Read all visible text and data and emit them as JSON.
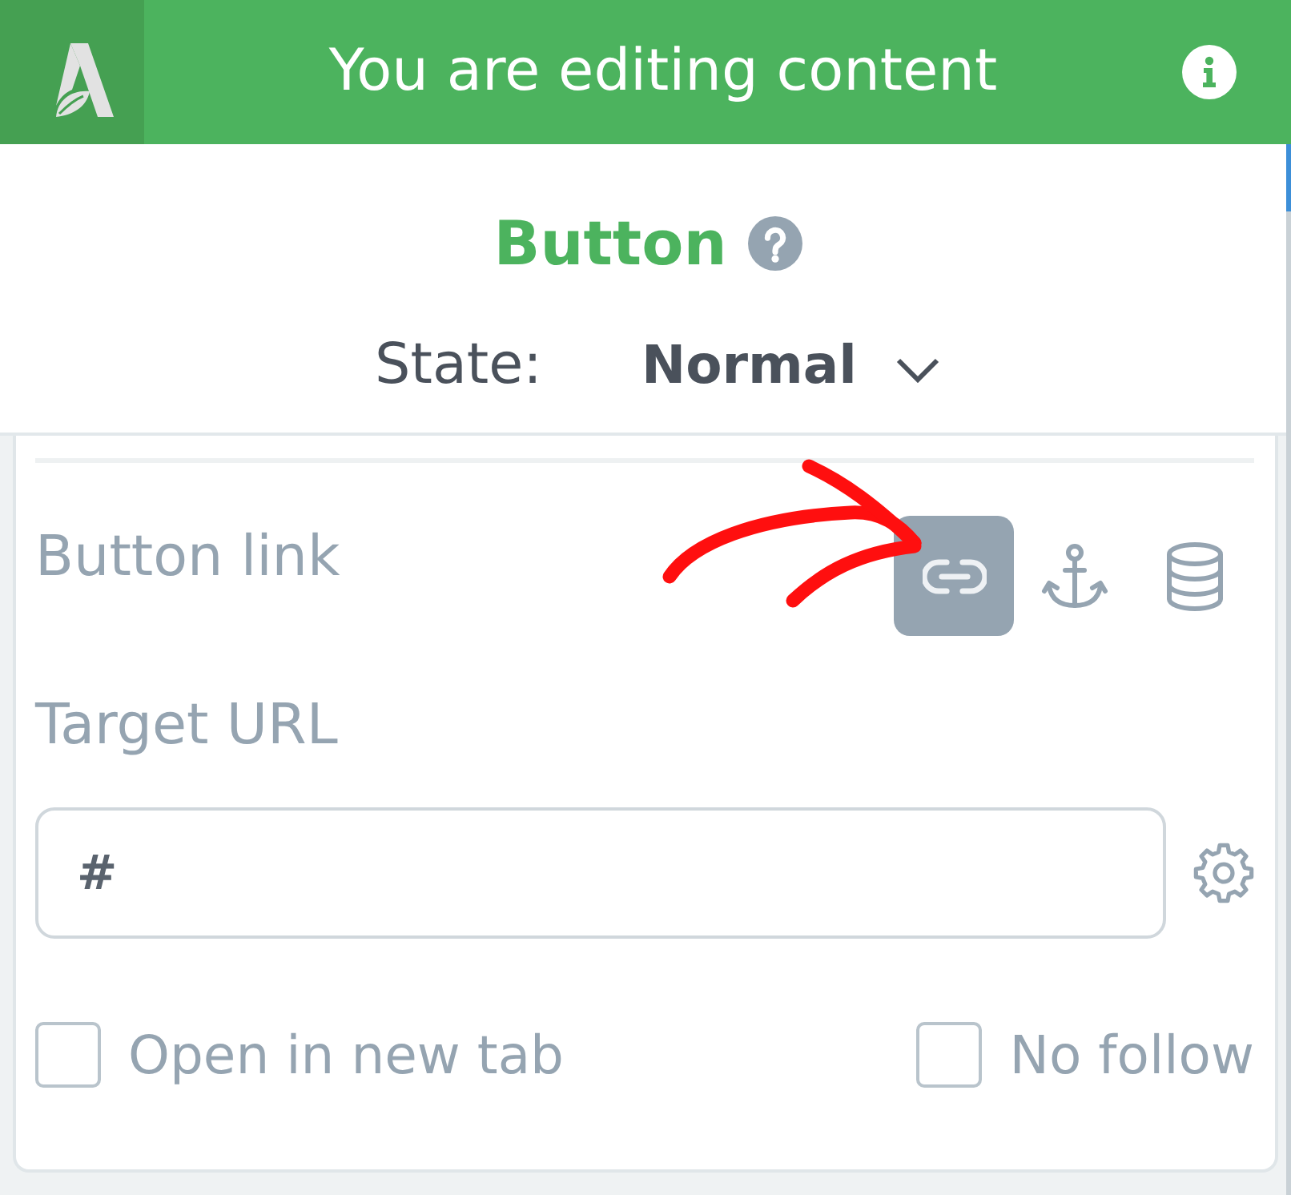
{
  "header": {
    "title": "You are editing content"
  },
  "element": {
    "title": "Button",
    "state_label": "State:",
    "state_value": "Normal"
  },
  "button_link": {
    "label": "Button link",
    "link_types": [
      {
        "kind": "url",
        "selected": true
      },
      {
        "kind": "anchor",
        "selected": false
      },
      {
        "kind": "database",
        "selected": false
      }
    ]
  },
  "target_url": {
    "label": "Target URL",
    "value": "#"
  },
  "options": [
    {
      "label": "Open in new tab",
      "checked": false
    },
    {
      "label": "No follow",
      "checked": false
    }
  ]
}
